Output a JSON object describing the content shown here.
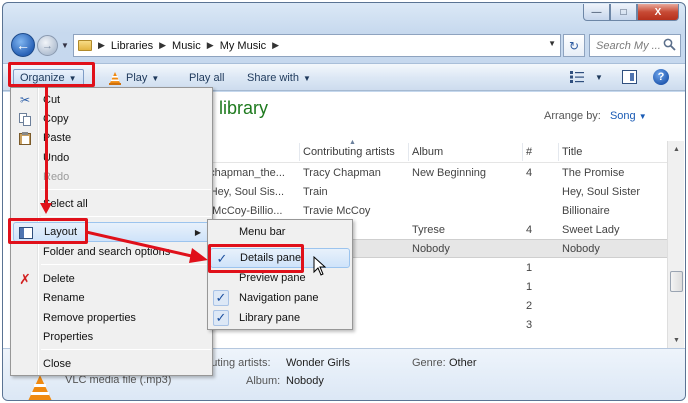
{
  "window": {
    "caption": {
      "minimize": "—",
      "maximize": "□",
      "close": "X"
    }
  },
  "address": {
    "crumbs": [
      "Libraries",
      "Music",
      "My Music"
    ],
    "search_placeholder": "Search My ..."
  },
  "toolbar": {
    "organize": "Organize",
    "play": "Play",
    "play_all": "Play all",
    "share_with": "Share with"
  },
  "content": {
    "library_title": "library",
    "library_sub": "c",
    "arrange_label": "Arrange by:",
    "arrange_value": "Song",
    "columns": [
      "Contributing artists",
      "Album",
      "#",
      "Title"
    ],
    "rows": [
      {
        "name": "_chapman_the...",
        "artist": "Tracy Chapman",
        "album": "New Beginning",
        "num": "4",
        "title": "The Promise"
      },
      {
        "name": "- Hey, Soul Sis...",
        "artist": "Train",
        "album": "",
        "num": "",
        "title": "Hey, Soul Sister"
      },
      {
        "name": "e McCoy-Billio...",
        "artist": "Travie McCoy",
        "album": "",
        "num": "",
        "title": "Billionaire"
      },
      {
        "name": "",
        "artist": "",
        "album": "Tyrese",
        "num": "4",
        "title": "Sweet Lady"
      },
      {
        "name": "",
        "artist": "rls",
        "album": "Nobody",
        "num": "",
        "title": "Nobody"
      },
      {
        "name": "",
        "artist": "",
        "album": "",
        "num": "1",
        "title": ""
      },
      {
        "name": "",
        "artist": "",
        "album": "",
        "num": "1",
        "title": ""
      },
      {
        "name": "",
        "artist": "",
        "album": "",
        "num": "2",
        "title": ""
      },
      {
        "name": "",
        "artist": "",
        "album": "",
        "num": "3",
        "title": ""
      }
    ]
  },
  "details": {
    "artists_label": "ributing artists:",
    "artists_value": "Wonder Girls",
    "genre_label": "Genre:",
    "genre_value": "Other",
    "album_label": "Album:",
    "album_value": "Nobody",
    "file_type": "VLC media file (.mp3)"
  },
  "organize_menu": {
    "items": [
      {
        "label": "Cut",
        "icon": "scissors-icon"
      },
      {
        "label": "Copy",
        "icon": "copy-icon"
      },
      {
        "label": "Paste",
        "icon": "paste-icon"
      },
      {
        "label": "Undo"
      },
      {
        "label": "Redo",
        "disabled": true
      },
      {
        "label": "Select all"
      },
      {
        "label": "Layout",
        "icon": "layout-icon"
      },
      {
        "label": "Folder and search options"
      },
      {
        "label": "Delete",
        "icon": "delete-icon"
      },
      {
        "label": "Rename"
      },
      {
        "label": "Remove properties"
      },
      {
        "label": "Properties"
      },
      {
        "label": "Close"
      }
    ]
  },
  "layout_submenu": {
    "items": [
      {
        "label": "Menu bar",
        "checked": false
      },
      {
        "label": "Details pane",
        "checked": true
      },
      {
        "label": "Preview pane",
        "checked": false
      },
      {
        "label": "Navigation pane",
        "checked": true
      },
      {
        "label": "Library pane",
        "checked": true
      }
    ]
  },
  "colors": {
    "annotation_red": "#e0101a",
    "library_green": "#1e7a1e",
    "link_blue": "#1a5bb5"
  }
}
